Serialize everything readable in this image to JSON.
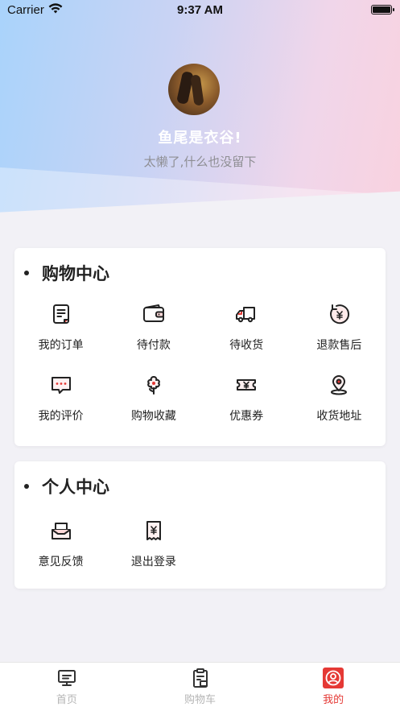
{
  "status_bar": {
    "carrier": "Carrier",
    "time": "9:37 AM"
  },
  "profile": {
    "name": "鱼尾是衣谷!",
    "bio": "太懒了,什么也没留下"
  },
  "shopping_center": {
    "title": "购物中心",
    "items": [
      {
        "label": "我的订单",
        "icon": "order-icon"
      },
      {
        "label": "待付款",
        "icon": "wallet-icon"
      },
      {
        "label": "待收货",
        "icon": "truck-icon"
      },
      {
        "label": "退款售后",
        "icon": "refund-icon"
      },
      {
        "label": "我的评价",
        "icon": "comment-icon"
      },
      {
        "label": "购物收藏",
        "icon": "favorite-icon"
      },
      {
        "label": "优惠券",
        "icon": "coupon-icon"
      },
      {
        "label": "收货地址",
        "icon": "location-icon"
      }
    ]
  },
  "personal_center": {
    "title": "个人中心",
    "items": [
      {
        "label": "意见反馈",
        "icon": "feedback-icon"
      },
      {
        "label": "退出登录",
        "icon": "logout-icon"
      }
    ]
  },
  "tabbar": {
    "tabs": [
      {
        "label": "首页",
        "icon": "home-icon",
        "active": false
      },
      {
        "label": "购物车",
        "icon": "cart-icon",
        "active": false
      },
      {
        "label": "我的",
        "icon": "profile-icon",
        "active": true
      }
    ]
  },
  "colors": {
    "accent": "#e53935",
    "inactive_tab": "#b5b5b5"
  }
}
